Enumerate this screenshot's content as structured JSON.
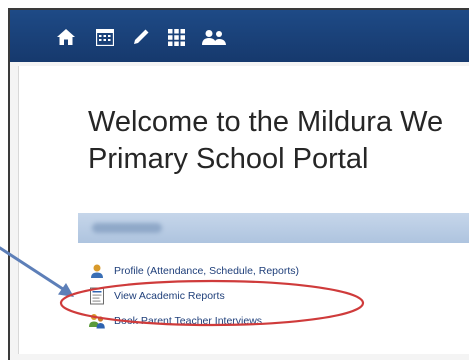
{
  "nav": {
    "icons": [
      "home-icon",
      "calendar-grid-icon",
      "pencil-icon",
      "apps-grid-icon",
      "people-icon"
    ]
  },
  "welcome": {
    "line1": "Welcome to the Mildura We",
    "line2": "Primary School Portal"
  },
  "links": [
    {
      "label": "Profile (Attendance, Schedule, Reports)",
      "icon": "profile-person-icon"
    },
    {
      "label": "View Academic Reports",
      "icon": "report-document-icon"
    },
    {
      "label": "Book Parent Teacher Interviews",
      "icon": "book-interview-icon"
    }
  ],
  "colors": {
    "topbar": "#1e4a86",
    "highlight_ellipse": "#cf3b3b",
    "arrow": "#5d7fb8",
    "link_text": "#1f3f7a"
  }
}
